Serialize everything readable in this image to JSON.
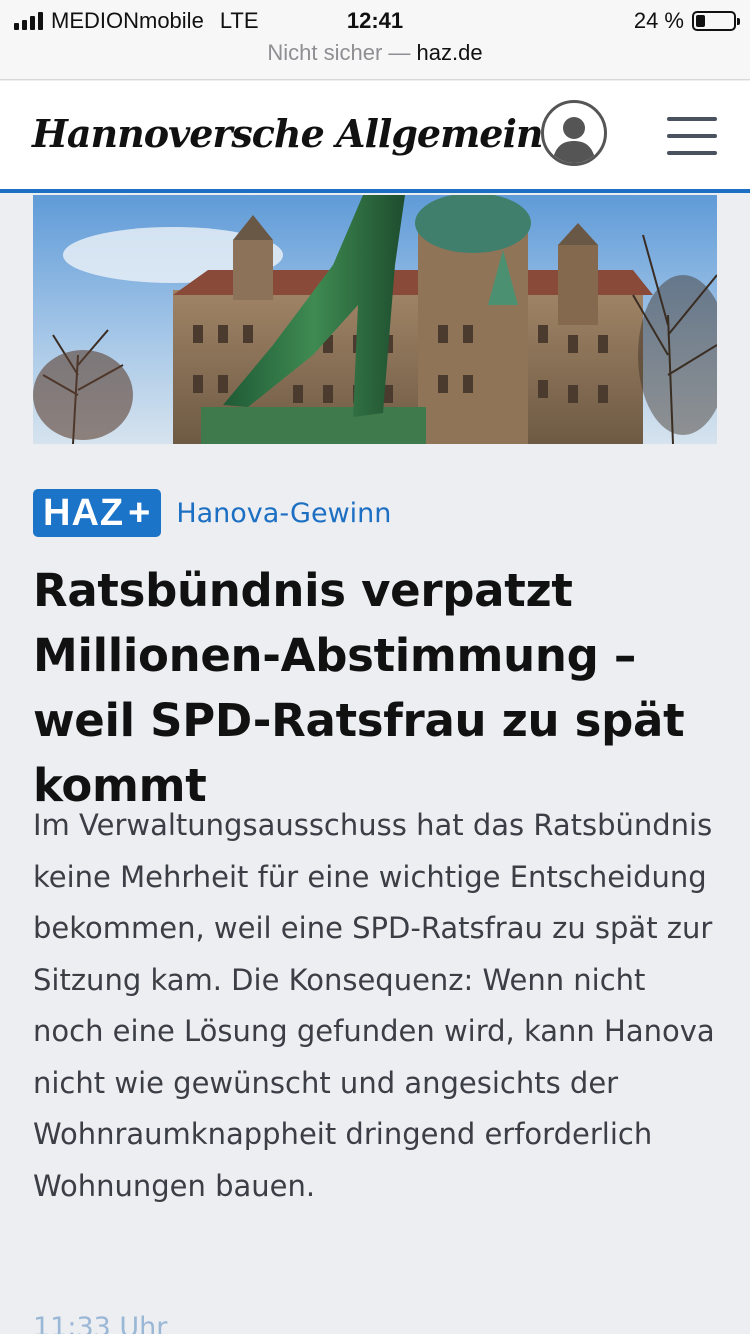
{
  "status_bar": {
    "carrier": "MEDIONmobile",
    "network": "LTE",
    "time": "12:41",
    "battery_percent": "24 %",
    "battery_level": 0.24
  },
  "url_bar": {
    "security": "Nicht sicher —",
    "host": "haz.de"
  },
  "site": {
    "logo_text": "Hannoversche Allgemeine",
    "accent_color": "#1c6fc2"
  },
  "article": {
    "badge": "HAZ",
    "badge_plus": "+",
    "kicker": "Hanova-Gewinn",
    "headline": "Ratsbündnis verpatzt Millionen-Abstimmung – weil SPD-Ratsfrau zu spät kommt",
    "teaser": "Im Verwaltungsausschuss hat das Ratsbündnis keine Mehrheit für eine wichtige Entscheidung bekommen, weil eine SPD-Ratsfrau zu spät zur Sitzung kam. Die Konsequenz: Wenn nicht noch eine Lösung gefunden wird, kann Hanova nicht wie gewünscht und angesichts der Wohnraumknappheit dringend erforderlich Wohnungen bauen.",
    "timestamp": "11:33 Uhr"
  },
  "icons": {
    "account": "user-icon",
    "menu": "hamburger-menu-icon"
  }
}
